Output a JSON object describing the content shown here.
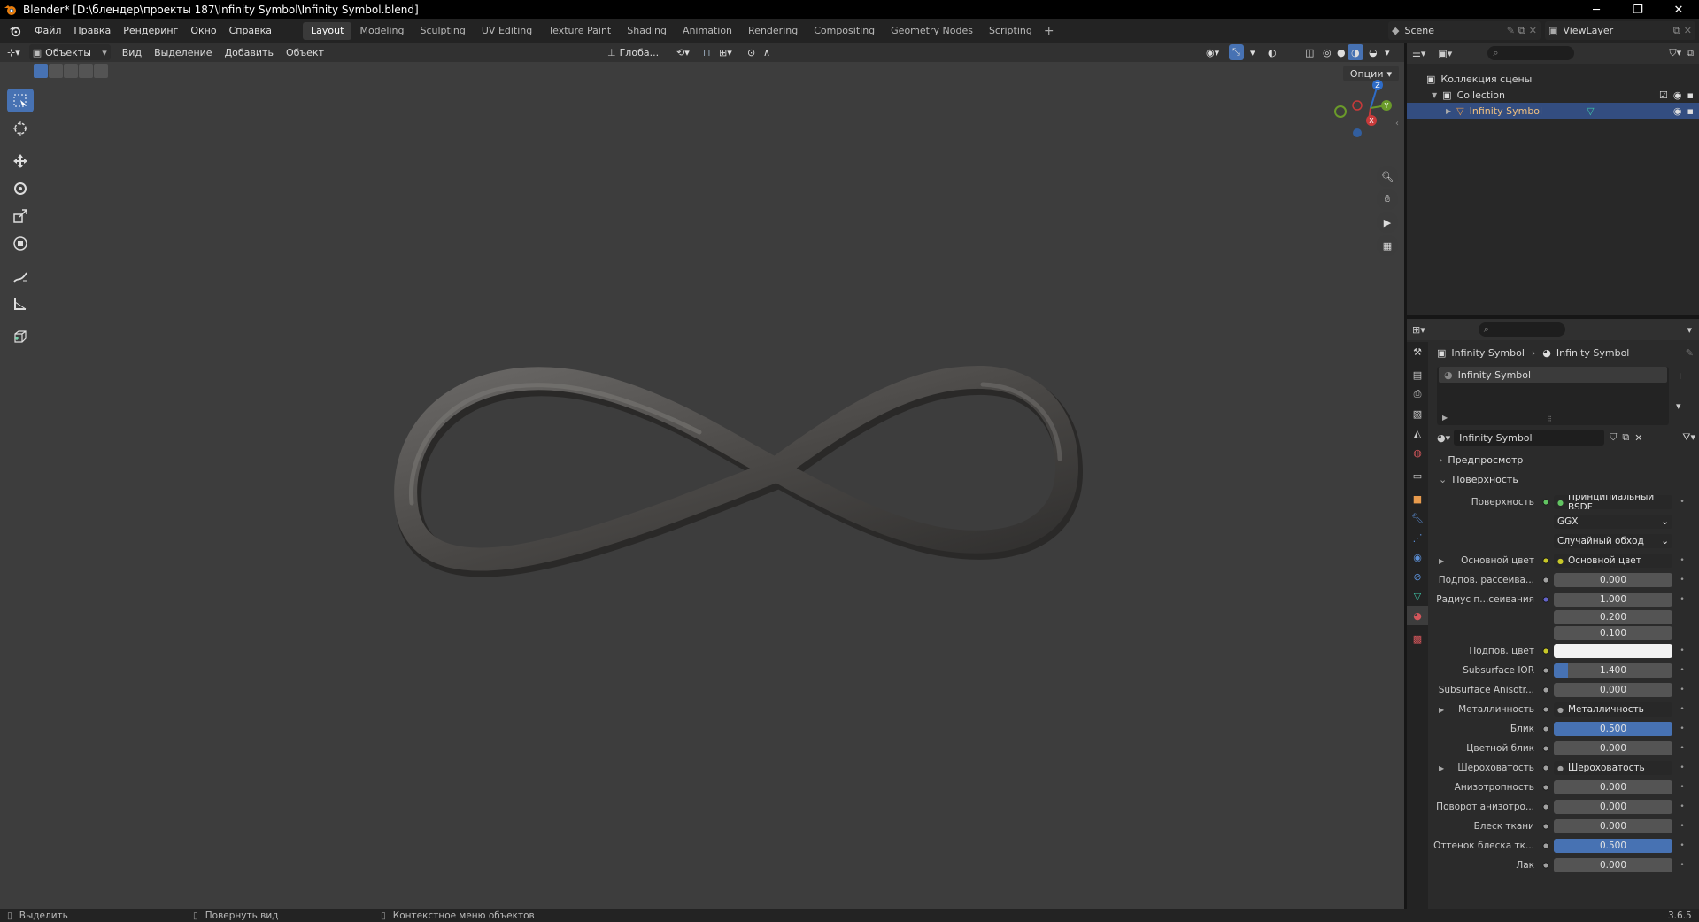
{
  "window": {
    "title": "Blender* [D:\\блендер\\проекты 187\\Infinity Symbol\\Infinity Symbol.blend]",
    "minimize": "─",
    "maximize": "❐",
    "close": "✕"
  },
  "menu": {
    "items": [
      "Файл",
      "Правка",
      "Рендеринг",
      "Окно",
      "Справка"
    ]
  },
  "workspaces": {
    "tabs": [
      "Layout",
      "Modeling",
      "Sculpting",
      "UV Editing",
      "Texture Paint",
      "Shading",
      "Animation",
      "Rendering",
      "Compositing",
      "Geometry Nodes",
      "Scripting"
    ],
    "active": "Layout",
    "add": "+"
  },
  "scene": {
    "label": "Scene",
    "view_layer": "ViewLayer"
  },
  "viewport": {
    "mode": "Объекты",
    "menus": [
      "Вид",
      "Выделение",
      "Добавить",
      "Объект"
    ],
    "transform_orientation": "Глоба...",
    "options": "Опции",
    "gizmo_axes": {
      "x": "X",
      "y": "Y",
      "z": "Z"
    },
    "object_color": "#4a4847"
  },
  "outliner": {
    "scene_collection": "Коллекция сцены",
    "collection": "Collection",
    "object": "Infinity Symbol"
  },
  "properties": {
    "breadcrumb_object": "Infinity Symbol",
    "breadcrumb_material": "Infinity Symbol",
    "slot": "Infinity Symbol",
    "material_name": "Infinity Symbol",
    "preview_label": "Предпросмотр",
    "surface_panel": "Поверхность",
    "rows": [
      {
        "label": "Поверхность",
        "value": "Принципиальный BSDF",
        "type": "link",
        "dot": "#62c462"
      },
      {
        "label": "",
        "value": "GGX",
        "type": "select"
      },
      {
        "label": "",
        "value": "Случайный обход",
        "type": "select"
      },
      {
        "label": "Основной цвет",
        "value": "Основной цвет",
        "type": "link",
        "dot": "#c8c829",
        "expand": true
      },
      {
        "label": "Подпов. рассеива...",
        "value": "0.000",
        "type": "number",
        "dot": "#a1a1a1",
        "fill": 0
      },
      {
        "label": "Радиус п...сеивания",
        "value": "1.000",
        "type": "number",
        "dot": "#6363c7",
        "fill": 0
      },
      {
        "label": "",
        "value": "0.200",
        "type": "number",
        "fill": 0
      },
      {
        "label": "",
        "value": "0.100",
        "type": "number",
        "fill": 0
      },
      {
        "label": "Подпов. цвет",
        "value": "",
        "type": "color",
        "dot": "#c8c829",
        "color": "#f2f2f2"
      },
      {
        "label": "Subsurface IOR",
        "value": "1.400",
        "type": "number",
        "dot": "#a1a1a1",
        "fill": 0.12
      },
      {
        "label": "Subsurface Anisotr...",
        "value": "0.000",
        "type": "number",
        "dot": "#a1a1a1",
        "fill": 0
      },
      {
        "label": "Металличность",
        "value": "Металличность",
        "type": "link",
        "dot": "#a1a1a1",
        "expand": true
      },
      {
        "label": "Блик",
        "value": "0.500",
        "type": "number",
        "dot": "#a1a1a1",
        "fill": 1
      },
      {
        "label": "Цветной блик",
        "value": "0.000",
        "type": "number",
        "dot": "#a1a1a1",
        "fill": 0
      },
      {
        "label": "Шероховатость",
        "value": "Шероховатость",
        "type": "link",
        "dot": "#a1a1a1",
        "expand": true
      },
      {
        "label": "Анизотропность",
        "value": "0.000",
        "type": "number",
        "dot": "#a1a1a1",
        "fill": 0
      },
      {
        "label": "Поворот анизотро...",
        "value": "0.000",
        "type": "number",
        "dot": "#a1a1a1",
        "fill": 0
      },
      {
        "label": "Блеск ткани",
        "value": "0.000",
        "type": "number",
        "dot": "#a1a1a1",
        "fill": 0
      },
      {
        "label": "Оттенок блеска тк...",
        "value": "0.500",
        "type": "number",
        "dot": "#a1a1a1",
        "fill": 1
      },
      {
        "label": "Лак",
        "value": "0.000",
        "type": "number",
        "dot": "#a1a1a1",
        "fill": 0
      }
    ]
  },
  "statusbar": {
    "select": "Выделить",
    "rotate": "Повернуть вид",
    "context": "Контекстное меню объектов",
    "version": "3.6.5"
  },
  "colors": {
    "accent": "#4772b3",
    "selected_row": "#334d80",
    "viewport_bg": "#3d3d3d"
  }
}
